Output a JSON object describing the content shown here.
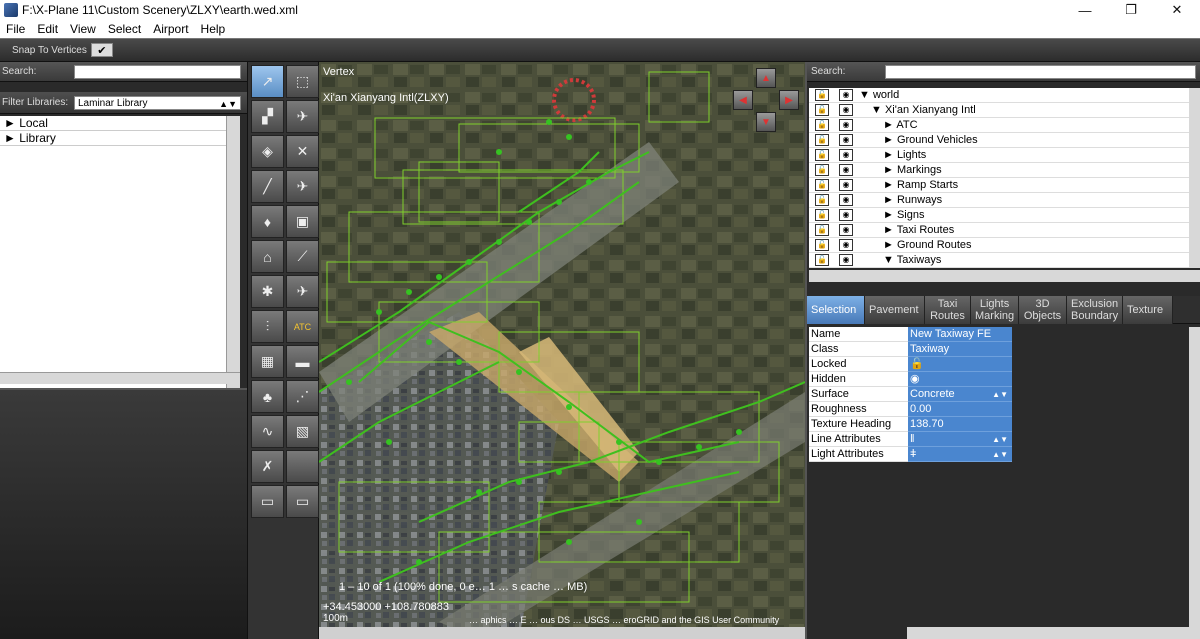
{
  "window": {
    "title": "F:\\X-Plane 11\\Custom Scenery\\ZLXY\\earth.wed.xml",
    "minimize": "—",
    "restore": "❐",
    "close": "✕"
  },
  "menu": [
    "File",
    "Edit",
    "View",
    "Select",
    "Airport",
    "Help"
  ],
  "toolbar": {
    "snap_label": "Snap To Vertices",
    "snap_check": "✔"
  },
  "library": {
    "search_label": "Search:",
    "filter_label": "Filter Libraries:",
    "filter_value": "Laminar Library",
    "items": [
      "► Local",
      "► Library"
    ]
  },
  "tools": [
    {
      "icon": "vertex-select-icon",
      "glyph": "↗",
      "active": true
    },
    {
      "icon": "marquee-icon",
      "glyph": "⬚",
      "active": false
    },
    {
      "icon": "runway-icon",
      "glyph": "▞",
      "active": false
    },
    {
      "icon": "helipad-icon",
      "glyph": "✈",
      "active": false
    },
    {
      "icon": "taxiway-icon",
      "glyph": "◈",
      "active": false
    },
    {
      "icon": "boundary-icon",
      "glyph": "✕",
      "active": false
    },
    {
      "icon": "taxi-line-icon",
      "glyph": "╱",
      "active": false
    },
    {
      "icon": "ramp-start-icon",
      "glyph": "✈",
      "active": false
    },
    {
      "icon": "light-fixture-icon",
      "glyph": "♦",
      "active": false
    },
    {
      "icon": "sign-icon",
      "glyph": "▣",
      "active": false
    },
    {
      "icon": "tower-icon",
      "glyph": "⌂",
      "active": false
    },
    {
      "icon": "windsock-icon",
      "glyph": "⟋",
      "active": false
    },
    {
      "icon": "beacon-icon",
      "glyph": "✱",
      "active": false
    },
    {
      "icon": "route-icon",
      "glyph": "✈",
      "active": false
    },
    {
      "icon": "atc-route-icon",
      "glyph": "⫶",
      "active": false
    },
    {
      "icon": "atc-icon",
      "glyph": "ATC",
      "active": false
    },
    {
      "icon": "building-icon",
      "glyph": "▦",
      "active": false
    },
    {
      "icon": "object-icon",
      "glyph": "▬",
      "active": false
    },
    {
      "icon": "forest-icon",
      "glyph": "♣",
      "active": false
    },
    {
      "icon": "line-icon",
      "glyph": "⋰",
      "active": false
    },
    {
      "icon": "polyline-icon",
      "glyph": "∿",
      "active": false
    },
    {
      "icon": "draped-polygon-icon",
      "glyph": "▧",
      "active": false
    },
    {
      "icon": "exclusion-icon",
      "glyph": "✗",
      "active": false
    },
    {
      "icon": "blank-tool-icon",
      "glyph": "",
      "active": false
    },
    {
      "icon": "truck-icon",
      "glyph": "▭",
      "active": false
    },
    {
      "icon": "vehicle-route-icon",
      "glyph": "▭",
      "active": false
    }
  ],
  "map": {
    "tool_name": "Vertex",
    "airport_name": "Xi'an Xianyang Intl(ZLXY)",
    "status": "1 – 10 of 1 (100% done, 0 e… 1 … s cache … MB)",
    "coords": "+34.453000 +108.780883",
    "scale": "100m",
    "credits": "… aphics … E … ous DS … USGS … eroGRID and the GIS User Community"
  },
  "hierarchy": {
    "search_label": "Search:",
    "rows": [
      {
        "indent": 0,
        "label": "▼ world"
      },
      {
        "indent": 1,
        "label": "▼ Xi'an Xianyang Intl"
      },
      {
        "indent": 2,
        "label": "► ATC"
      },
      {
        "indent": 2,
        "label": "► Ground Vehicles"
      },
      {
        "indent": 2,
        "label": "► Lights"
      },
      {
        "indent": 2,
        "label": "► Markings"
      },
      {
        "indent": 2,
        "label": "► Ramp Starts"
      },
      {
        "indent": 2,
        "label": "► Runways"
      },
      {
        "indent": 2,
        "label": "► Signs"
      },
      {
        "indent": 2,
        "label": "► Taxi Routes"
      },
      {
        "indent": 2,
        "label": "► Ground Routes"
      },
      {
        "indent": 2,
        "label": "▼ Taxiways"
      }
    ]
  },
  "tabs": [
    {
      "label": "Selection",
      "active": true
    },
    {
      "label": "Pavement",
      "active": false
    },
    {
      "label": "Taxi Routes",
      "active": false
    },
    {
      "label": "Lights Marking",
      "active": false
    },
    {
      "label": "3D Objects",
      "active": false
    },
    {
      "label": "Exclusion Boundary",
      "active": false
    },
    {
      "label": "Texture",
      "active": false
    }
  ],
  "properties": [
    {
      "name": "Name",
      "value": "New Taxiway FE",
      "arrow": ""
    },
    {
      "name": "Class",
      "value": "Taxiway",
      "arrow": ""
    },
    {
      "name": "Locked",
      "value": "🔓",
      "arrow": ""
    },
    {
      "name": "Hidden",
      "value": "◉",
      "arrow": ""
    },
    {
      "name": "Surface",
      "value": "Concrete",
      "arrow": "▲▼"
    },
    {
      "name": "Roughness",
      "value": "0.00",
      "arrow": ""
    },
    {
      "name": "Texture Heading",
      "value": "138.70",
      "arrow": ""
    },
    {
      "name": "Line Attributes",
      "value": "‖",
      "arrow": "▲▼"
    },
    {
      "name": "Light Attributes",
      "value": "ǂ",
      "arrow": "▲▼"
    }
  ]
}
